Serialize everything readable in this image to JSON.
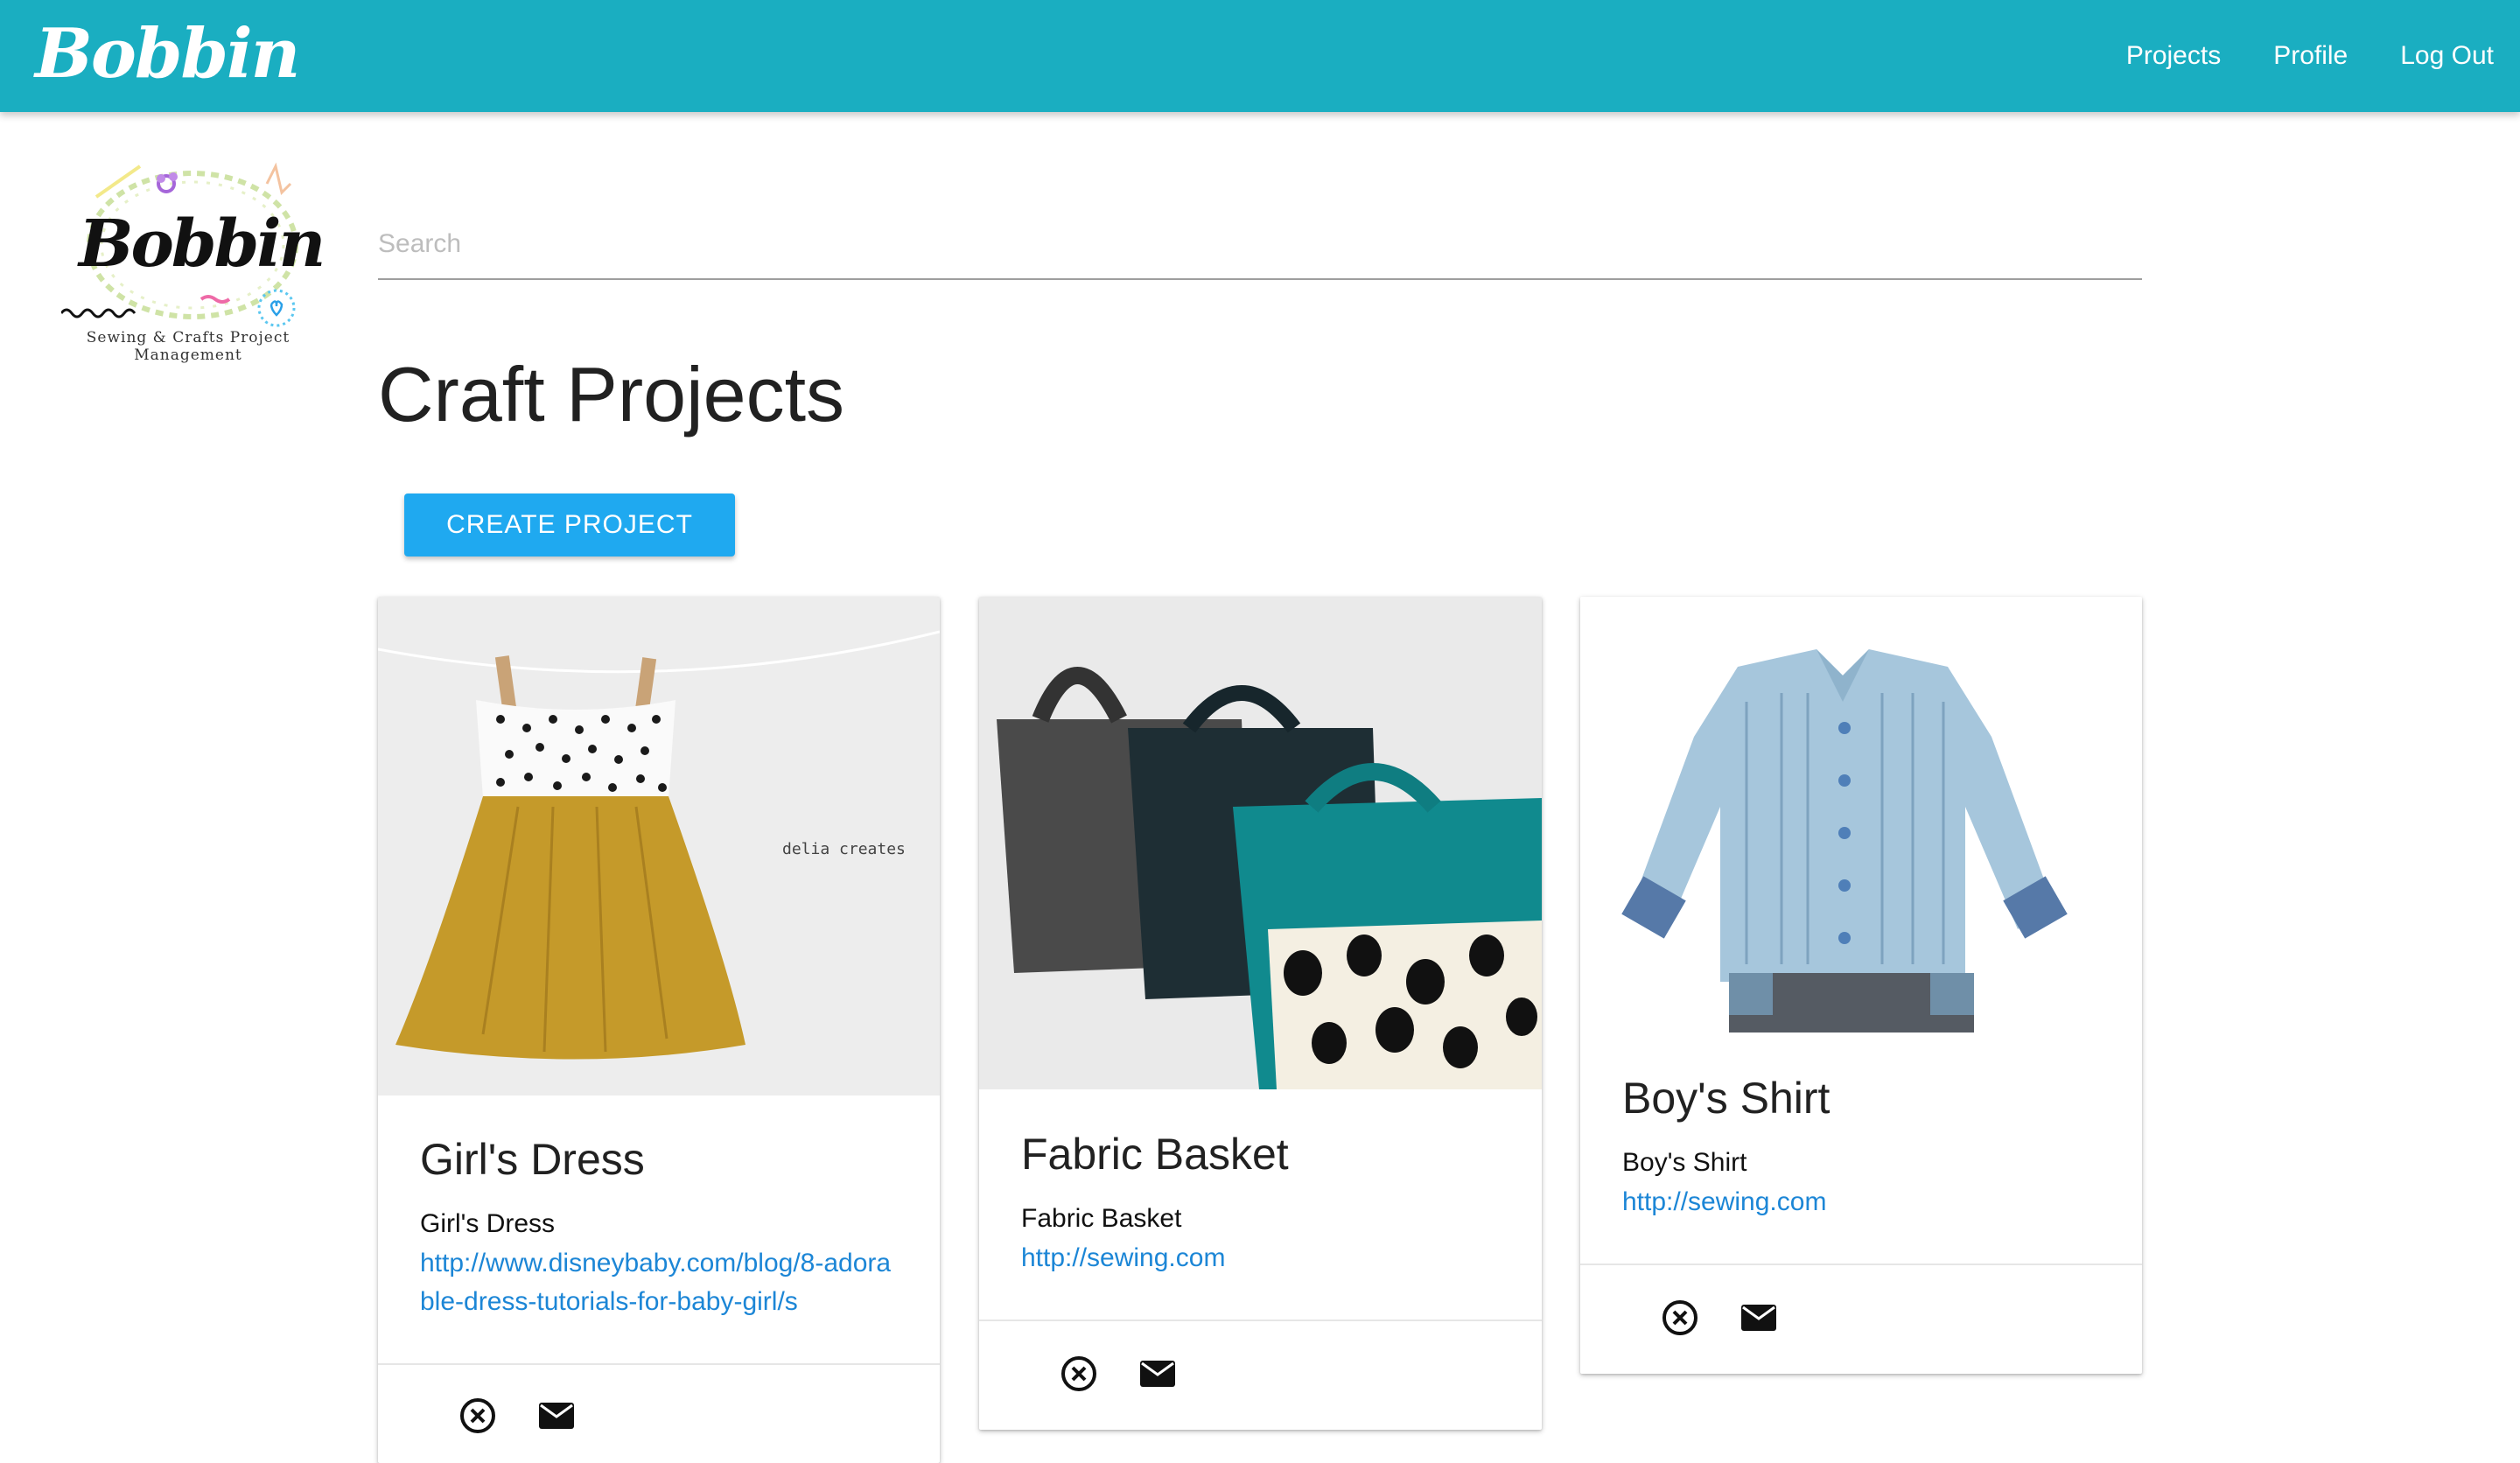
{
  "nav": {
    "brand": "Bobbin",
    "links": [
      "Projects",
      "Profile",
      "Log Out"
    ]
  },
  "sidebar": {
    "logo_title": "Bobbin",
    "logo_tagline": "Sewing & Crafts Project Management"
  },
  "search": {
    "placeholder": "Search",
    "value": ""
  },
  "main": {
    "title": "Craft Projects",
    "create_label": "CREATE PROJECT"
  },
  "cards": [
    {
      "title": "Girl's Dress",
      "description": "Girl's Dress",
      "link": "http://www.disneybaby.com/blog/8-adorable-dress-tutorials-for-baby-girl/s",
      "image_watermark": "delia creates",
      "actions": [
        "close-circle-icon",
        "mail-icon"
      ]
    },
    {
      "title": "Fabric Basket",
      "description": "Fabric Basket",
      "link": "http://sewing.com",
      "actions": [
        "close-circle-icon",
        "mail-icon"
      ]
    },
    {
      "title": "Boy's Shirt",
      "description": "Boy's Shirt",
      "link": "http://sewing.com",
      "actions": [
        "close-circle-icon",
        "mail-icon"
      ]
    }
  ],
  "colors": {
    "navbar": "#1aaec1",
    "button": "#1fa9f0",
    "link": "#1c86d6"
  }
}
